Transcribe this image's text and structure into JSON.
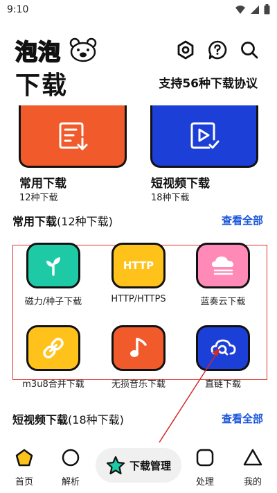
{
  "status": {
    "time": "9:10"
  },
  "header": {
    "logo_text": "泡泡",
    "title": "下载",
    "protocol_text": "支持56种下载协议"
  },
  "feature_cards": [
    {
      "title": "常用下载",
      "sub": "12种下载",
      "color": "#f15a2b",
      "icon": "download-list-icon"
    },
    {
      "title": "短视频下载",
      "sub": "18种下载",
      "color": "#1c3fd8",
      "icon": "video-icon"
    }
  ],
  "common_section": {
    "title_bold": "常用下载",
    "title_rest": "(12种下载)",
    "view_all": "查看全部"
  },
  "common_items": [
    {
      "label": "磁力/种子下载",
      "color": "#1ec9a6",
      "icon": "sprout-icon"
    },
    {
      "label": "HTTP/HTTPS",
      "color": "#ffc21a",
      "icon": "http-icon",
      "icon_text": "HTTP"
    },
    {
      "label": "蓝奏云下载",
      "color": "#ff8ab8",
      "icon": "cloud-icon"
    },
    {
      "label": "m3u8合并下载",
      "color": "#ffc21a",
      "icon": "link-icon"
    },
    {
      "label": "无损音乐下载",
      "color": "#f15a2b",
      "icon": "music-note-icon"
    },
    {
      "label": "直链下载",
      "color": "#1c3fd8",
      "icon": "cloud-search-icon"
    }
  ],
  "video_section": {
    "title_bold": "短视频下载",
    "title_rest": "(18种下载)",
    "view_all": "查看全部"
  },
  "bottom_nav": {
    "home": "首页",
    "parse": "解析",
    "center": "下载管理",
    "process": "处理",
    "mine": "我的"
  },
  "colors": {
    "accent": "#1a56db",
    "highlight_box": "#e03030",
    "home_icon": "#ffc21a",
    "center_star": "#1ec9a6"
  }
}
